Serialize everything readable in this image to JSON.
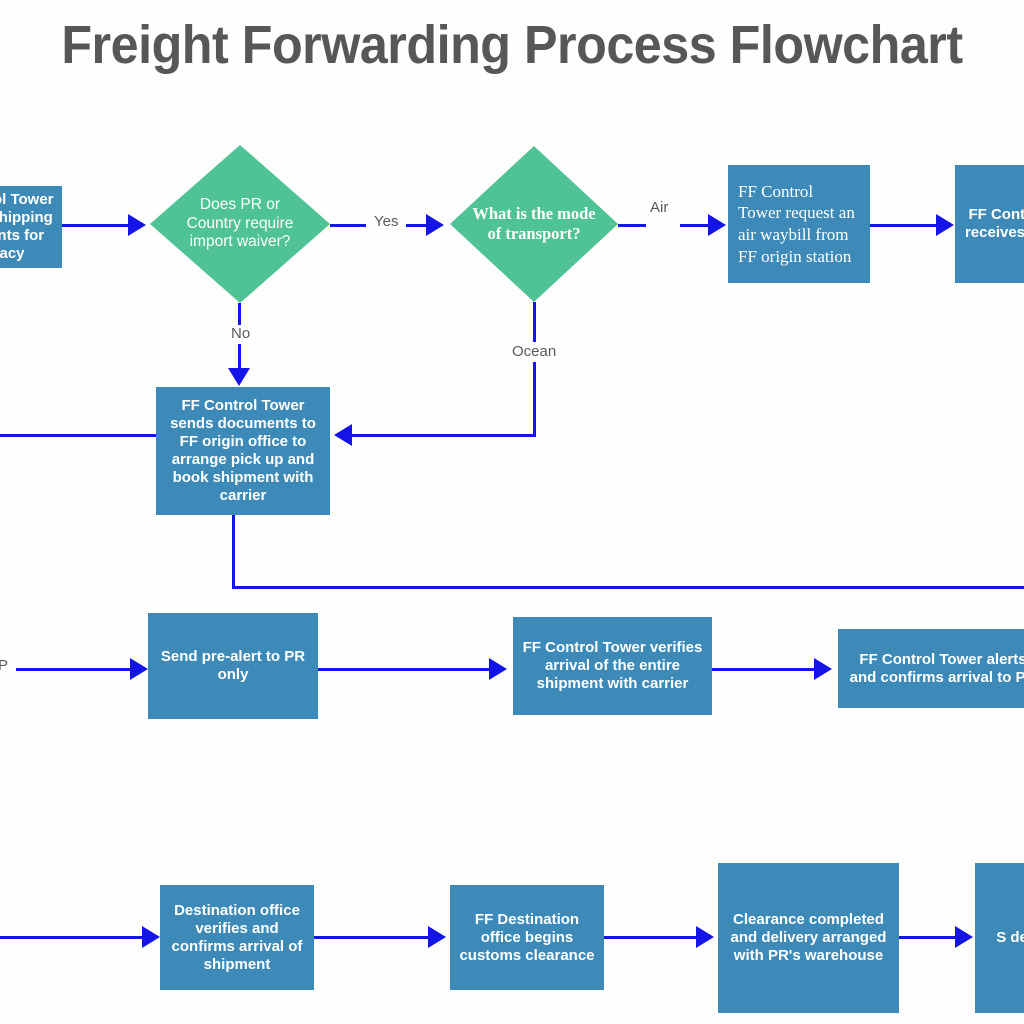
{
  "title": "Freight Forwarding Process Flowchart",
  "theme": {
    "process_fill": "#3d8ab8",
    "decision_fill": "#4fc296",
    "connector": "#1414e6",
    "title_color": "#575757",
    "label_color": "#5a5a5a",
    "node_text": "#ffffff",
    "background": "#fefefe"
  },
  "nodes": {
    "review_docs": {
      "type": "process",
      "text": "FF Control Tower reviews shipping documents for accuracy",
      "clipped": "left"
    },
    "waiver_decision": {
      "type": "decision",
      "text": "Does PR or Country require import waiver?"
    },
    "mode_decision": {
      "type": "decision",
      "text": "What is the mode  of transport?"
    },
    "request_awb": {
      "type": "process",
      "text": "FF Control Tower request an air  waybill from FF origin station"
    },
    "receives_awb": {
      "type": "process",
      "text": "FF Control Tower receives copy of a",
      "clipped": "right"
    },
    "send_docs": {
      "type": "process",
      "text": "FF Control Tower sends documents to FF origin office to arrange pick up and book shipment with carrier"
    },
    "pre_alert": {
      "type": "process",
      "text": "Send pre-alert to PR only"
    },
    "verify_arrival": {
      "type": "process",
      "text": "FF Control Tower verifies arrival of the entire shipment with carrier"
    },
    "alerts_pr": {
      "type": "process",
      "text": "FF Control Tower alerts and confirms arrival to PR",
      "clipped": "right"
    },
    "dest_verifies": {
      "type": "process",
      "text": "Destination office verifies and confirms arrival of shipment"
    },
    "customs_clearance": {
      "type": "process",
      "text": "FF Destination office begins customs clearance"
    },
    "clearance_done": {
      "type": "process",
      "text": "Clearance completed and delivery arranged with PR's warehouse"
    },
    "final_step": {
      "type": "process",
      "text": "S delive se",
      "clipped": "right"
    }
  },
  "edge_labels": {
    "yes": "Yes",
    "no": "No",
    "air": "Air",
    "ocean": "Ocean",
    "partial_left": "P"
  }
}
